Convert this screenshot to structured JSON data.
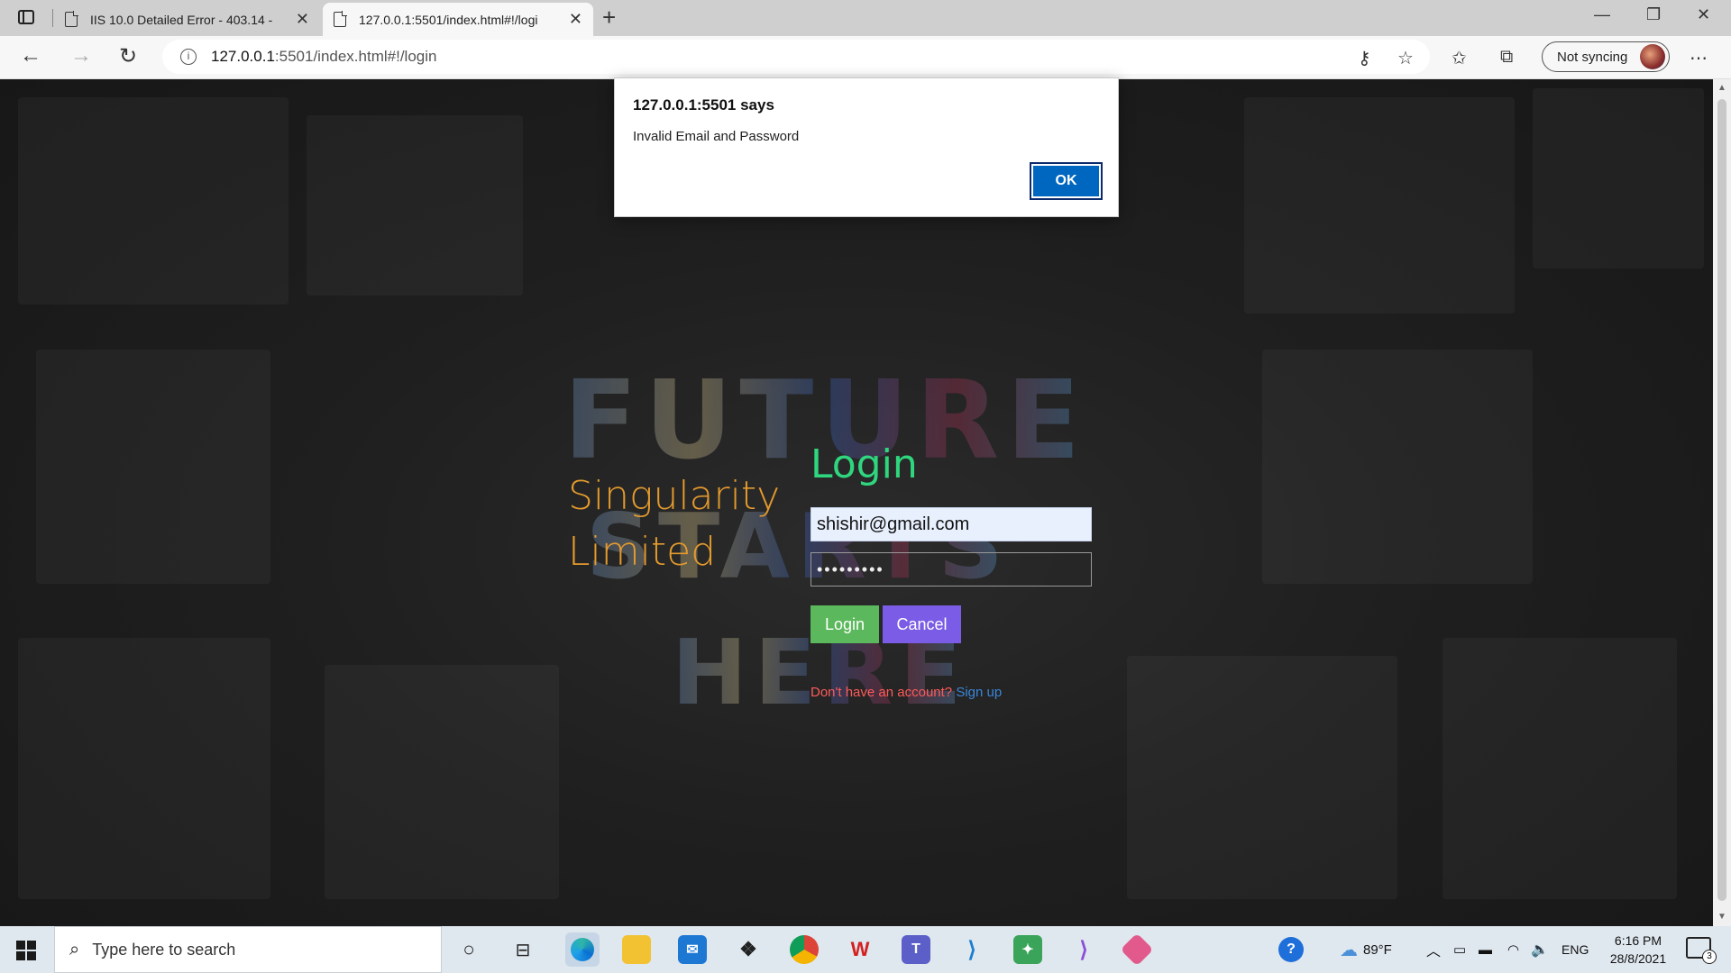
{
  "browser": {
    "tabs": [
      {
        "title": "IIS 10.0 Detailed Error - 403.14 - ",
        "active": false
      },
      {
        "title": "127.0.0.1:5501/index.html#!/logi",
        "active": true
      }
    ],
    "address_host": "127.0.0.1",
    "address_rest": ":5501/index.html#!/login",
    "sync_label": "Not syncing"
  },
  "dialog": {
    "title": "127.0.0.1:5501 says",
    "message": "Invalid Email and Password",
    "ok_label": "OK"
  },
  "page": {
    "brand_line1": "Singularity",
    "brand_line2": "Limited",
    "login_heading": "Login",
    "email_value": "shishir@gmail.com",
    "password_mask": "•••••••••",
    "login_button": "Login",
    "cancel_button": "Cancel",
    "signup_question": "Don't have an account?",
    "signup_link": "Sign up",
    "bg_words": [
      "FUTURE",
      "STARTS",
      "HERE"
    ]
  },
  "taskbar": {
    "search_placeholder": "Type here to search",
    "weather": "89°F",
    "language": "ENG",
    "time": "6:16 PM",
    "date": "28/8/2021",
    "notification_count": "3"
  }
}
